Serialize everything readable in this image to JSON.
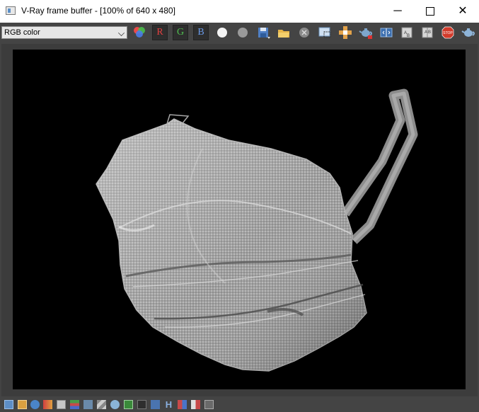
{
  "window": {
    "title": "V-Ray frame buffer - [100% of 640 x 480]",
    "controls": {
      "minimize": "─",
      "close": "✕"
    }
  },
  "toolbar": {
    "channel_select": {
      "value": "RGB color"
    },
    "channels": {
      "red": "R",
      "green": "G",
      "blue": "B"
    },
    "stop_label": "STOP",
    "icons": [
      "color-balls-icon",
      "red-channel",
      "green-channel",
      "blue-channel",
      "white-circle-icon",
      "gray-circle-icon",
      "save-icon",
      "open-folder-icon",
      "clear-icon",
      "region-render-icon",
      "track-mouse-icon",
      "teapot-icon",
      "compare-icon",
      "ab-horizontal-icon",
      "ab-vertical-icon",
      "stop-icon",
      "render-teapot-icon"
    ]
  },
  "render": {
    "width": 640,
    "height": 480,
    "subject": "face mask render (grayscale)"
  },
  "statusbar": {
    "hist_label": "H",
    "icons": [
      "status-window-icon",
      "history-icon",
      "info-icon",
      "color-correction-icon",
      "lut-icon",
      "levels-icon",
      "curves-icon",
      "background-icon",
      "lens-effects-icon",
      "image-icon",
      "ocio-icon",
      "icc-icon",
      "h-icon",
      "stereo-icon",
      "split-icon",
      "settings-icon"
    ]
  }
}
